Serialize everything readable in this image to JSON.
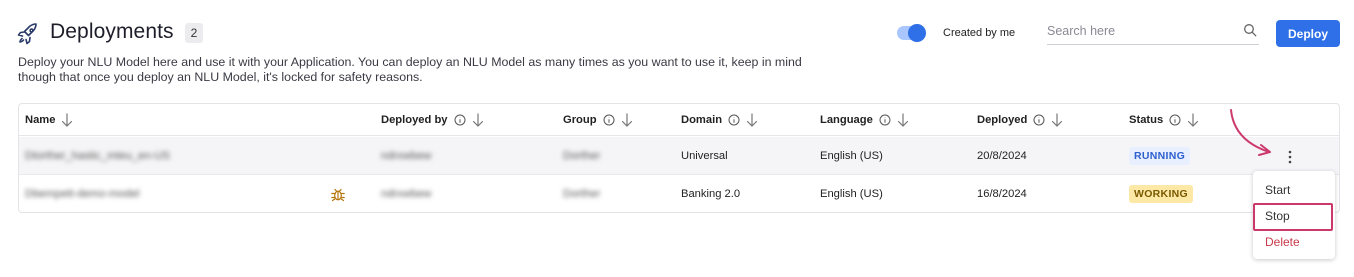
{
  "header": {
    "title": "Deployments",
    "count": "2",
    "description": "Deploy your NLU Model here and use it with your Application. You can deploy an NLU Model as many times as you want to use it, keep in mind though that once you deploy an NLU Model, it's locked for safety reasons.",
    "toggle_label": "Created by me",
    "toggle_on": true,
    "search_placeholder": "Search here",
    "deploy_label": "Deploy"
  },
  "table": {
    "columns": [
      "Name",
      "Deployed by",
      "Group",
      "Domain",
      "Language",
      "Deployed",
      "Status"
    ],
    "rows": [
      {
        "name": "Dtorther_hastic_mteu_en-US",
        "deployed_by": "ndrxwbew",
        "group": "Dorther",
        "domain": "Universal",
        "language": "English (US)",
        "deployed": "20/8/2024",
        "status": "RUNNING"
      },
      {
        "name": "Dbempett-demo-model",
        "deployed_by": "ndrxwbew",
        "group": "Dorther",
        "domain": "Banking 2.0",
        "language": "English (US)",
        "deployed": "16/8/2024",
        "status": "WORKING"
      }
    ]
  },
  "menu": {
    "items": [
      "Start",
      "Stop",
      "Delete"
    ]
  },
  "colors": {
    "accent": "#2f6fe8",
    "running_bg": "#e8efff",
    "working_bg": "#fde8a6",
    "delete": "#c83b4c",
    "annotation": "#cc3a6d"
  }
}
